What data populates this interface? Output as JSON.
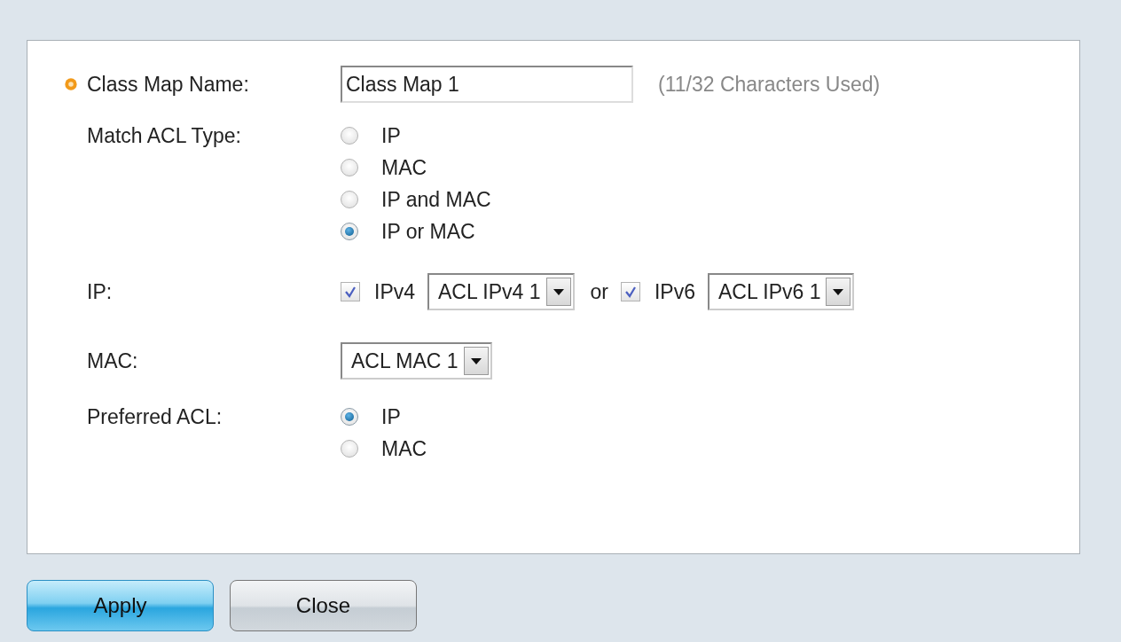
{
  "class_map_name": {
    "label": "Class Map Name:",
    "required": true,
    "value": "Class Map 1",
    "hint": "(11/32 Characters Used)"
  },
  "match_acl_type": {
    "label": "Match ACL Type:",
    "options": [
      {
        "label": "IP",
        "selected": false
      },
      {
        "label": "MAC",
        "selected": false
      },
      {
        "label": "IP and MAC",
        "selected": false
      },
      {
        "label": "IP or MAC",
        "selected": true
      }
    ]
  },
  "ip": {
    "label": "IP:",
    "ipv4": {
      "label": "IPv4",
      "checked": true,
      "value": "ACL IPv4 1"
    },
    "separator": "or",
    "ipv6": {
      "label": "IPv6",
      "checked": true,
      "value": "ACL IPv6 1"
    }
  },
  "mac": {
    "label": "MAC:",
    "value": "ACL MAC 1"
  },
  "preferred_acl": {
    "label": "Preferred ACL:",
    "options": [
      {
        "label": "IP",
        "selected": true
      },
      {
        "label": "MAC",
        "selected": false
      }
    ]
  },
  "buttons": [
    {
      "label": "Apply",
      "kind": "primary"
    },
    {
      "label": "Close",
      "kind": "secondary"
    }
  ]
}
